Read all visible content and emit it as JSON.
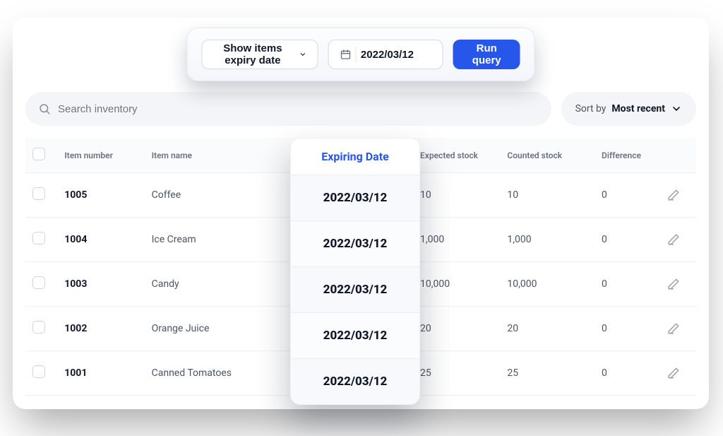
{
  "query_panel": {
    "dropdown_label": "Show items expiry date",
    "date_value": "2022/03/12",
    "run_label": "Run query"
  },
  "toolbar": {
    "search_placeholder": "Search inventory",
    "sort_prefix": "Sort by",
    "sort_value": "Most recent"
  },
  "table": {
    "headers": {
      "item_number": "Item number",
      "item_name": "Item name",
      "expiring_date": "Expiring Date",
      "expected_stock": "Expected stock",
      "counted_stock": "Counted stock",
      "difference": "Difference"
    },
    "rows": [
      {
        "item_number": "1005",
        "item_name": "Coffee",
        "expiring_date": "2022/03/12",
        "expected_stock": "10",
        "counted_stock": "10",
        "difference": "0"
      },
      {
        "item_number": "1004",
        "item_name": "Ice Cream",
        "expiring_date": "2022/03/12",
        "expected_stock": "1,000",
        "counted_stock": "1,000",
        "difference": "0"
      },
      {
        "item_number": "1003",
        "item_name": "Candy",
        "expiring_date": "2022/03/12",
        "expected_stock": "10,000",
        "counted_stock": "10,000",
        "difference": "0"
      },
      {
        "item_number": "1002",
        "item_name": "Orange Juice",
        "expiring_date": "2022/03/12",
        "expected_stock": "20",
        "counted_stock": "20",
        "difference": "0"
      },
      {
        "item_number": "1001",
        "item_name": "Canned Tomatoes",
        "expiring_date": "2022/03/12",
        "expected_stock": "25",
        "counted_stock": "25",
        "difference": "0"
      }
    ]
  },
  "expiry_overlay": {
    "header": "Expiring Date",
    "values": [
      "2022/03/12",
      "2022/03/12",
      "2022/03/12",
      "2022/03/12",
      "2022/03/12"
    ]
  },
  "icons": {
    "chevron_down": "chevron-down-icon",
    "calendar": "calendar-icon",
    "search": "search-icon",
    "edit": "edit-icon"
  },
  "colors": {
    "primary": "#2756ea",
    "text": "#0f1728",
    "muted": "#6b7280",
    "surface": "#f3f5f8"
  }
}
